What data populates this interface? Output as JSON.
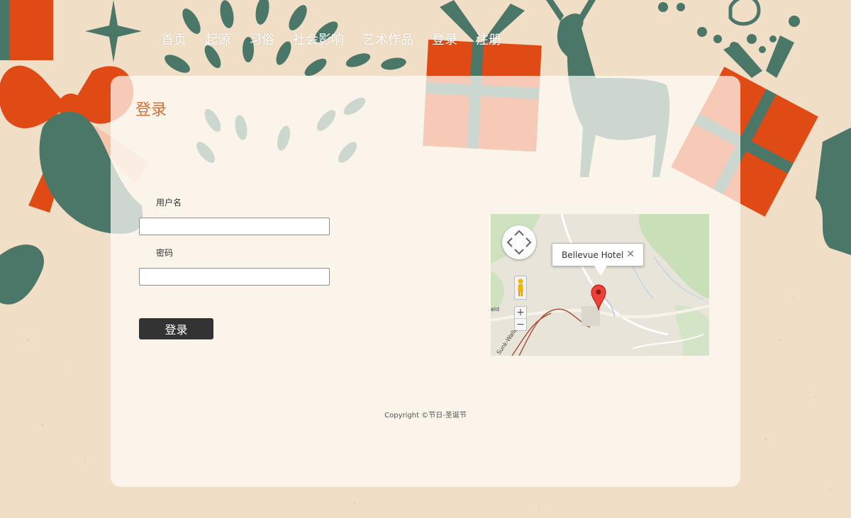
{
  "nav": {
    "items": [
      {
        "label": "首页"
      },
      {
        "label": "起源"
      },
      {
        "label": "习俗"
      },
      {
        "label": "社会影响"
      },
      {
        "label": "艺术作品"
      },
      {
        "label": "登录"
      },
      {
        "label": "注册"
      }
    ]
  },
  "page": {
    "title": "登录"
  },
  "form": {
    "username_label": "用户名",
    "username_value": "",
    "password_label": "密码",
    "password_value": "",
    "submit_label": "登录"
  },
  "map": {
    "info_label": "Bellevue Hotel",
    "close_glyph": "✕",
    "zoom_in": "+",
    "zoom_out": "−",
    "road_label": "Sunk-Wallegg",
    "left_label": "eld"
  },
  "footer": {
    "copyright": "Copyright ©节日-圣诞节"
  },
  "colors": {
    "background": "#f1dec6",
    "teal": "#4a7768",
    "orange": "#e04a14",
    "salmon": "#f4c4ad",
    "title": "#d4713a",
    "button": "#333333"
  }
}
